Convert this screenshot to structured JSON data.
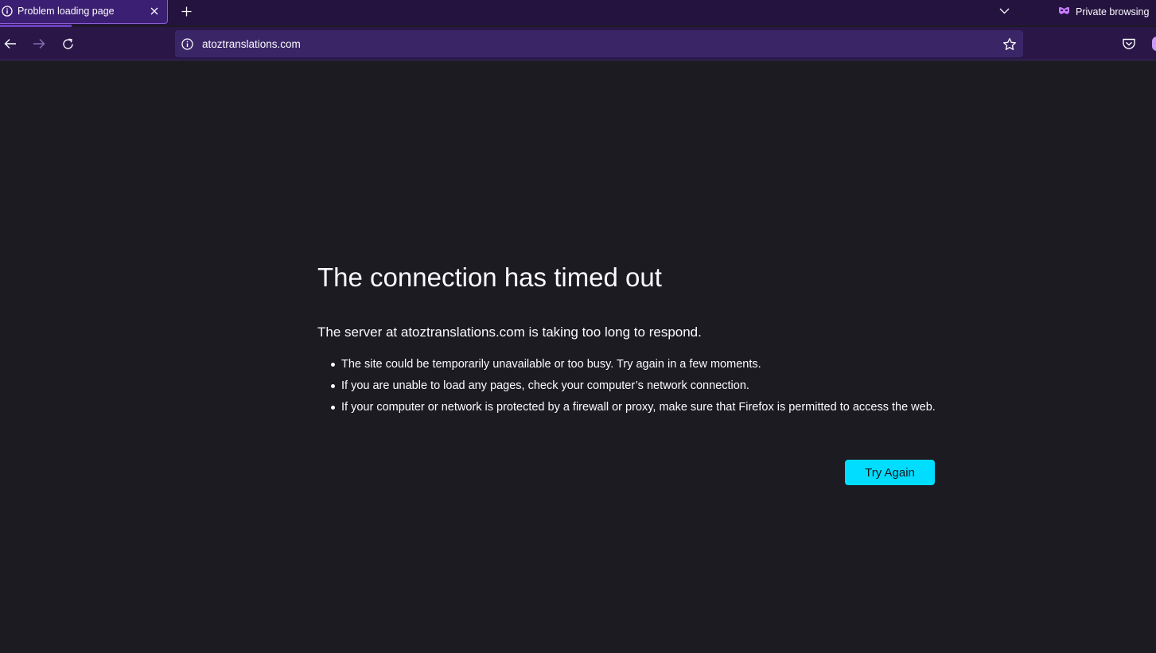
{
  "browser": {
    "tab": {
      "title": "Problem loading page"
    },
    "private_label": "Private browsing",
    "url": "atoztranslations.com",
    "accent_color": "#00ddff"
  },
  "icons": {
    "tab": "info-icon",
    "close": "close-icon",
    "new_tab": "plus-icon",
    "tab_list": "chevron-down-icon",
    "private": "private-mask-icon",
    "back": "back-arrow-icon",
    "forward": "forward-arrow-icon",
    "reload": "reload-icon",
    "site_info": "info-icon",
    "bookmark": "star-icon",
    "pocket": "pocket-icon"
  },
  "error": {
    "title": "The connection has timed out",
    "description": "The server at atoztranslations.com is taking too long to respond.",
    "suggestions": [
      "The site could be temporarily unavailable or too busy. Try again in a few moments.",
      "If you are unable to load any pages, check your computer’s network connection.",
      "If your computer or network is protected by a firewall or proxy, make sure that Firefox is permitted to access the web."
    ],
    "try_again_label": "Try Again"
  }
}
